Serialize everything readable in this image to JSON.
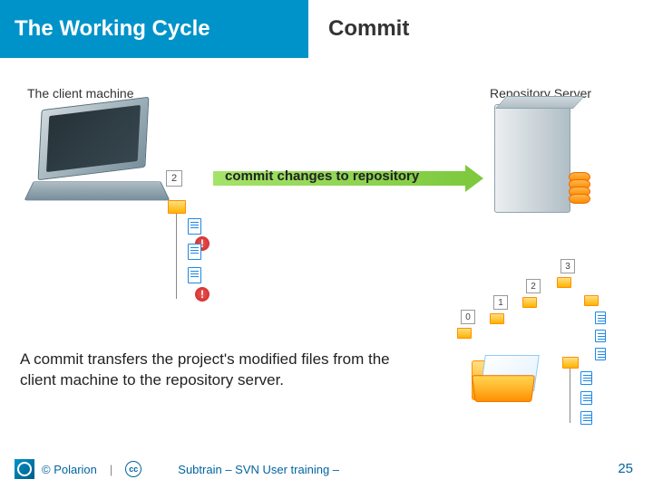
{
  "header": {
    "title_left": "The Working Cycle",
    "title_right": "Commit"
  },
  "labels": {
    "client": "The client machine",
    "repo": "Repository Server"
  },
  "arrow_text": "commit changes to repository",
  "client_rev": "2",
  "stack_revs": [
    "0",
    "1",
    "2",
    "3"
  ],
  "caption": "A commit transfers the project's modified files from the client machine to the repository server.",
  "footer": {
    "copyright": "© Polarion",
    "cc": "cc",
    "mid": "Subtrain – SVN User training –",
    "page": "25"
  }
}
